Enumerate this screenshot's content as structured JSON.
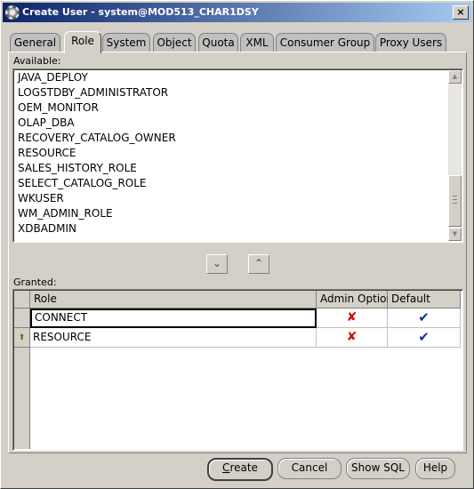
{
  "window": {
    "title": "Create User - system@MOD513_CHAR1DSY",
    "close_glyph": "×"
  },
  "tabs": [
    "General",
    "Role",
    "System",
    "Object",
    "Quota",
    "XML",
    "Consumer Group",
    "Proxy Users"
  ],
  "active_tab": "Role",
  "available": {
    "label": "Available:",
    "items": [
      "JAVA_DEPLOY",
      "LOGSTDBY_ADMINISTRATOR",
      "OEM_MONITOR",
      "OLAP_DBA",
      "RECOVERY_CATALOG_OWNER",
      "RESOURCE",
      "SALES_HISTORY_ROLE",
      "SELECT_CATALOG_ROLE",
      "WKUSER",
      "WM_ADMIN_ROLE",
      "XDBADMIN"
    ]
  },
  "move_buttons": {
    "down_glyph": "⌄",
    "up_glyph": "⌃"
  },
  "granted": {
    "label": "Granted:",
    "columns": [
      "Role",
      "Admin Option",
      "Default"
    ],
    "rows": [
      {
        "role": "CONNECT",
        "admin_option": "✘",
        "default": "✔"
      },
      {
        "role": "RESOURCE",
        "admin_option": "✘",
        "default": "✔"
      }
    ],
    "row_marker": "⬆"
  },
  "buttons": {
    "create_prefix": "",
    "create_mnemonic": "C",
    "create_rest": "reate",
    "cancel": "Cancel",
    "show_sql": "Show SQL",
    "help": "Help"
  }
}
